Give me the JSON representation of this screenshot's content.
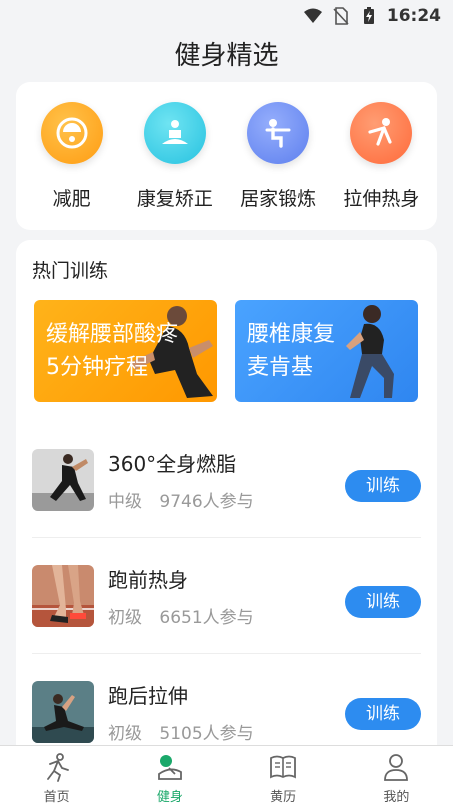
{
  "status_bar": {
    "time": "16:24"
  },
  "header": {
    "title": "健身精选"
  },
  "categories": [
    {
      "label": "减肥",
      "icon": "scale-icon",
      "color": "#ffa51e"
    },
    {
      "label": "康复矫正",
      "icon": "meditation-icon",
      "color": "#3fd0e6"
    },
    {
      "label": "居家锻炼",
      "icon": "squat-icon",
      "color": "#6e8ff5"
    },
    {
      "label": "拉伸热身",
      "icon": "stretch-icon",
      "color": "#ff7a4d"
    }
  ],
  "hot": {
    "title": "热门训练",
    "banners": [
      {
        "line1": "缓解腰部酸疼",
        "line2": "5分钟疗程"
      },
      {
        "line1": "腰椎康复",
        "line2": "麦肯基"
      }
    ],
    "items": [
      {
        "name": "360°全身燃脂",
        "level": "中级",
        "participants": "9746人参与",
        "button": "训练"
      },
      {
        "name": "跑前热身",
        "level": "初级",
        "participants": "6651人参与",
        "button": "训练"
      },
      {
        "name": "跑后拉伸",
        "level": "初级",
        "participants": "5105人参与",
        "button": "训练"
      }
    ]
  },
  "tabbar": {
    "tabs": [
      {
        "label": "首页",
        "icon": "runner-icon"
      },
      {
        "label": "健身",
        "icon": "fitness-icon",
        "active": true
      },
      {
        "label": "黄历",
        "icon": "book-icon"
      },
      {
        "label": "我的",
        "icon": "person-icon"
      }
    ]
  },
  "colors": {
    "accent": "#2d8cf0",
    "active_tab": "#1aa86a"
  }
}
